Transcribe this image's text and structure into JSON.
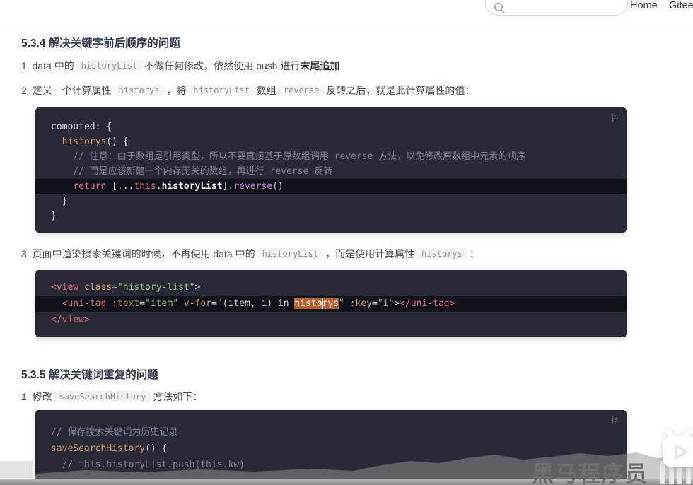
{
  "navbar": {
    "home_label": "Home",
    "gitee_label": "Gitee",
    "search_value": ""
  },
  "headings": {
    "s534": "5.3.4 解决关键字前后顺序的问题",
    "s535": "5.3.5 解决关键词重复的问题"
  },
  "list_items": {
    "item1": [
      {
        "t": "text",
        "v": "1. data 中的"
      },
      {
        "t": "code",
        "v": "historyList"
      },
      {
        "t": "text",
        "v": "不做任何修改，依然使用 push 进行"
      },
      {
        "t": "bold",
        "v": "末尾追加"
      }
    ],
    "item2": [
      {
        "t": "text",
        "v": "2. 定义一个计算属性"
      },
      {
        "t": "code",
        "v": "historys"
      },
      {
        "t": "text",
        "v": "，将"
      },
      {
        "t": "code",
        "v": "historyList"
      },
      {
        "t": "text",
        "v": "数组"
      },
      {
        "t": "code",
        "v": "reverse"
      },
      {
        "t": "text",
        "v": "反转之后，就是此计算属性的值："
      }
    ],
    "item3": [
      {
        "t": "text",
        "v": "3. 页面中渲染搜索关键词的时候，不再使用 data 中的"
      },
      {
        "t": "code",
        "v": "historyList"
      },
      {
        "t": "text",
        "v": "，而是使用计算属性"
      },
      {
        "t": "code",
        "v": "historys"
      },
      {
        "t": "text",
        "v": "："
      }
    ],
    "item4": [
      {
        "t": "text",
        "v": "1. 修改"
      },
      {
        "t": "code",
        "v": "saveSearchHistory"
      },
      {
        "t": "text",
        "v": "方法如下："
      }
    ]
  },
  "code_blocks": [
    {
      "lang": "js",
      "lines": [
        {
          "hl": false,
          "tokens": [
            {
              "c": "plain",
              "v": "computed: {"
            }
          ]
        },
        {
          "hl": false,
          "tokens": [
            {
              "c": "plain",
              "v": "  "
            },
            {
              "c": "fn",
              "v": "historys"
            },
            {
              "c": "plain",
              "v": "() {"
            }
          ]
        },
        {
          "hl": false,
          "tokens": [
            {
              "c": "com",
              "v": "    // 注意：由于数组是引用类型，所以不要直接基于原数组调用 reverse 方法，以免修改原数组中元素的顺序"
            }
          ]
        },
        {
          "hl": false,
          "tokens": [
            {
              "c": "com",
              "v": "    // 而是应该新建一个内存无关的数组，再进行 reverse 反转"
            }
          ]
        },
        {
          "hl": true,
          "tokens": [
            {
              "c": "plain",
              "v": "    "
            },
            {
              "c": "kw",
              "v": "return"
            },
            {
              "c": "plain",
              "v": " [..."
            },
            {
              "c": "kw",
              "v": "this"
            },
            {
              "c": "plain",
              "v": "."
            },
            {
              "c": "prop",
              "v": "historyList"
            },
            {
              "c": "plain",
              "v": "]."
            },
            {
              "c": "pur",
              "v": "reverse"
            },
            {
              "c": "plain",
              "v": "()"
            }
          ]
        },
        {
          "hl": false,
          "tokens": [
            {
              "c": "plain",
              "v": "  }"
            }
          ]
        },
        {
          "hl": false,
          "tokens": [
            {
              "c": "plain",
              "v": "}"
            }
          ]
        }
      ]
    },
    {
      "lang": "",
      "lines": [
        {
          "hl": false,
          "tokens": [
            {
              "c": "kw",
              "v": "<view"
            },
            {
              "c": "attr",
              "v": " class"
            },
            {
              "c": "plain",
              "v": "="
            },
            {
              "c": "str",
              "v": "\"history-list\""
            },
            {
              "c": "plain",
              "v": ">"
            }
          ]
        },
        {
          "hl": true,
          "tokens": [
            {
              "c": "plain",
              "v": "  "
            },
            {
              "c": "kw",
              "v": "<uni-tag"
            },
            {
              "c": "attr",
              "v": " :text"
            },
            {
              "c": "plain",
              "v": "="
            },
            {
              "c": "str",
              "v": "\"item\""
            },
            {
              "c": "attr",
              "v": " v-for"
            },
            {
              "c": "plain",
              "v": "="
            },
            {
              "c": "str",
              "v": "\""
            },
            {
              "c": "plain",
              "v": "(item, i) in "
            },
            {
              "c": "sel",
              "v": "histo"
            },
            {
              "c": "caret",
              "v": ""
            },
            {
              "c": "sel",
              "v": "rys"
            },
            {
              "c": "str",
              "v": "\""
            },
            {
              "c": "attr",
              "v": " :key"
            },
            {
              "c": "plain",
              "v": "="
            },
            {
              "c": "str",
              "v": "\"i\""
            },
            {
              "c": "plain",
              "v": ">"
            },
            {
              "c": "kw",
              "v": "</uni-tag>"
            }
          ]
        },
        {
          "hl": false,
          "tokens": [
            {
              "c": "kw",
              "v": "</view>"
            }
          ]
        }
      ]
    },
    {
      "lang": "js",
      "lines": [
        {
          "hl": false,
          "tokens": [
            {
              "c": "com",
              "v": "// 保存搜索关键词为历史记录"
            }
          ]
        },
        {
          "hl": false,
          "tokens": [
            {
              "c": "fn",
              "v": "saveSearchHistory"
            },
            {
              "c": "plain",
              "v": "() {"
            }
          ]
        },
        {
          "hl": false,
          "tokens": [
            {
              "c": "com",
              "v": "  // this.historyList.push(this.kw)"
            }
          ]
        }
      ]
    }
  ],
  "watermark": {
    "text": "黑马程序员"
  },
  "colors": {
    "code_bg": "#282b36",
    "code_highlight_bg": "#101219",
    "selection_orange": "#c05a28",
    "keyword_red": "#e06c75",
    "string_green": "#98c379",
    "attr_orange": "#d19a66",
    "purple": "#c678dd",
    "comment_gray": "#7b8496"
  }
}
